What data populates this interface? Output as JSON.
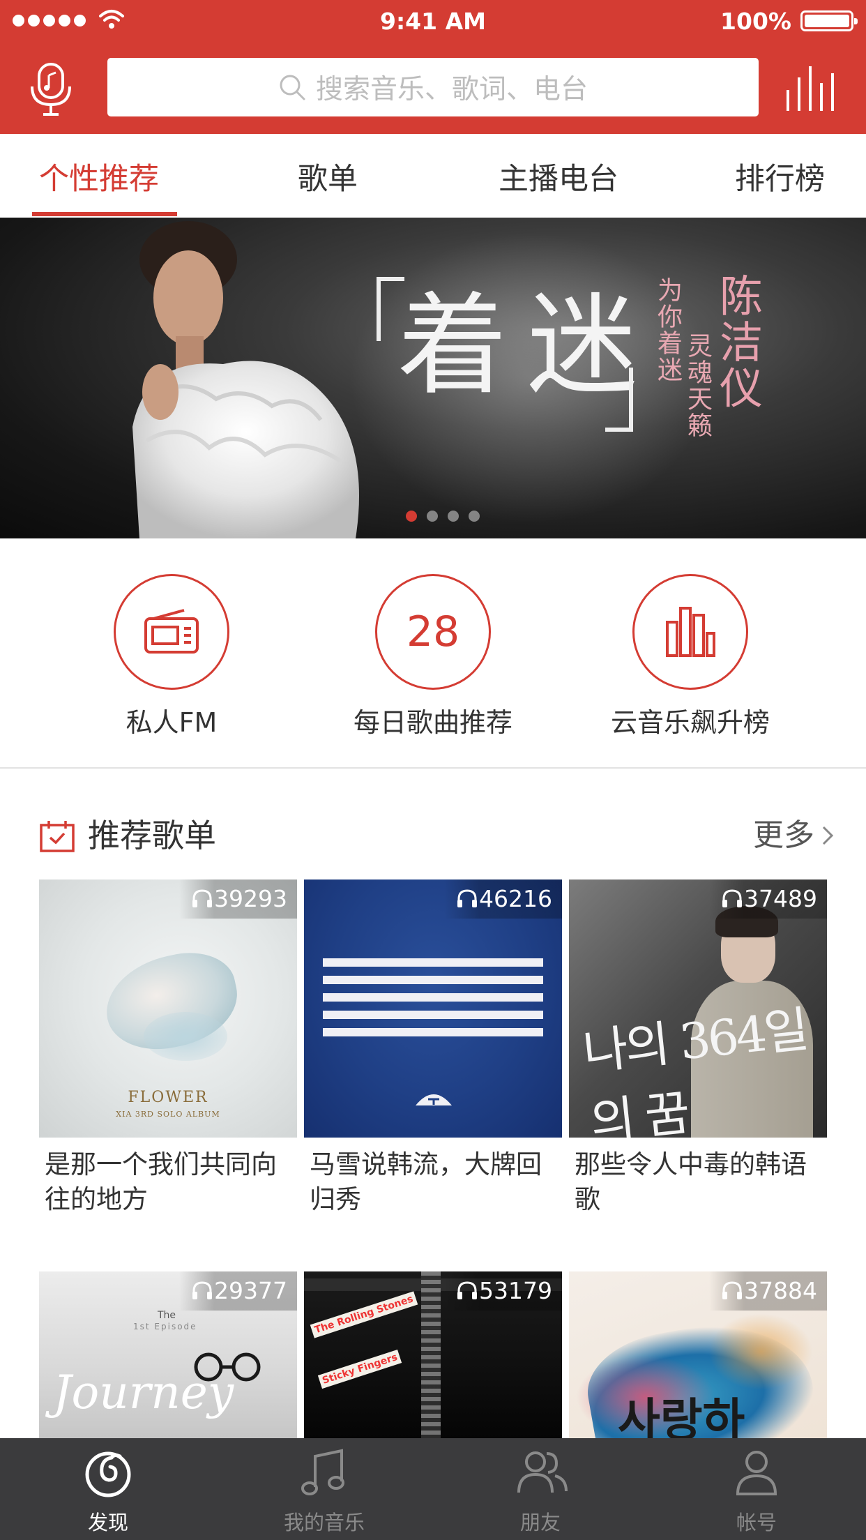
{
  "status_bar": {
    "time": "9:41 AM",
    "battery": "100%"
  },
  "search": {
    "placeholder": "搜索音乐、歌词、电台"
  },
  "tabs": [
    {
      "label": "个性推荐",
      "active": true
    },
    {
      "label": "歌单",
      "active": false
    },
    {
      "label": "主播电台",
      "active": false
    },
    {
      "label": "排行榜",
      "active": false
    }
  ],
  "banner": {
    "headline": "着迷",
    "tagline_1": "为你着迷",
    "tagline_2": "灵魂天籁",
    "artist": "陈洁仪",
    "page_count": 4,
    "active_page": 1
  },
  "shortcuts": [
    {
      "label": "私人FM",
      "icon": "radio-icon"
    },
    {
      "label": "每日歌曲推荐",
      "icon": "calendar-day-icon",
      "day": "28"
    },
    {
      "label": "云音乐飙升榜",
      "icon": "chart-bars-icon"
    }
  ],
  "recommend": {
    "title": "推荐歌单",
    "more": "更多",
    "playlists": [
      {
        "title": "是那一个我们共同向往的地方",
        "plays": "39293"
      },
      {
        "title": "马雪说韩流，大牌回归秀",
        "plays": "46216"
      },
      {
        "title": "那些令人中毒的韩语歌",
        "plays": "37489"
      },
      {
        "title": "",
        "plays": "29377"
      },
      {
        "title": "",
        "plays": "53179"
      },
      {
        "title": "",
        "plays": "37884"
      }
    ],
    "cover_text": {
      "flower": "FLOWER",
      "flower_sub": "XIA 3RD SOLO ALBUM",
      "korean_1": "나의 364일의 꿈",
      "journey": "Journey",
      "journey_the": "The",
      "journey_sub": "1st Episode",
      "stones_1": "The Rolling Stones",
      "stones_2": "Sticky Fingers",
      "korean_2": "사랑하"
    }
  },
  "bottom_nav": [
    {
      "label": "发现",
      "icon": "netease-logo-icon",
      "active": true
    },
    {
      "label": "我的音乐",
      "icon": "music-note-icon",
      "active": false
    },
    {
      "label": "朋友",
      "icon": "friends-icon",
      "active": false
    },
    {
      "label": "帐号",
      "icon": "account-icon",
      "active": false
    }
  ],
  "colors": {
    "brand": "#d43c33",
    "nav_bg": "#202022"
  }
}
